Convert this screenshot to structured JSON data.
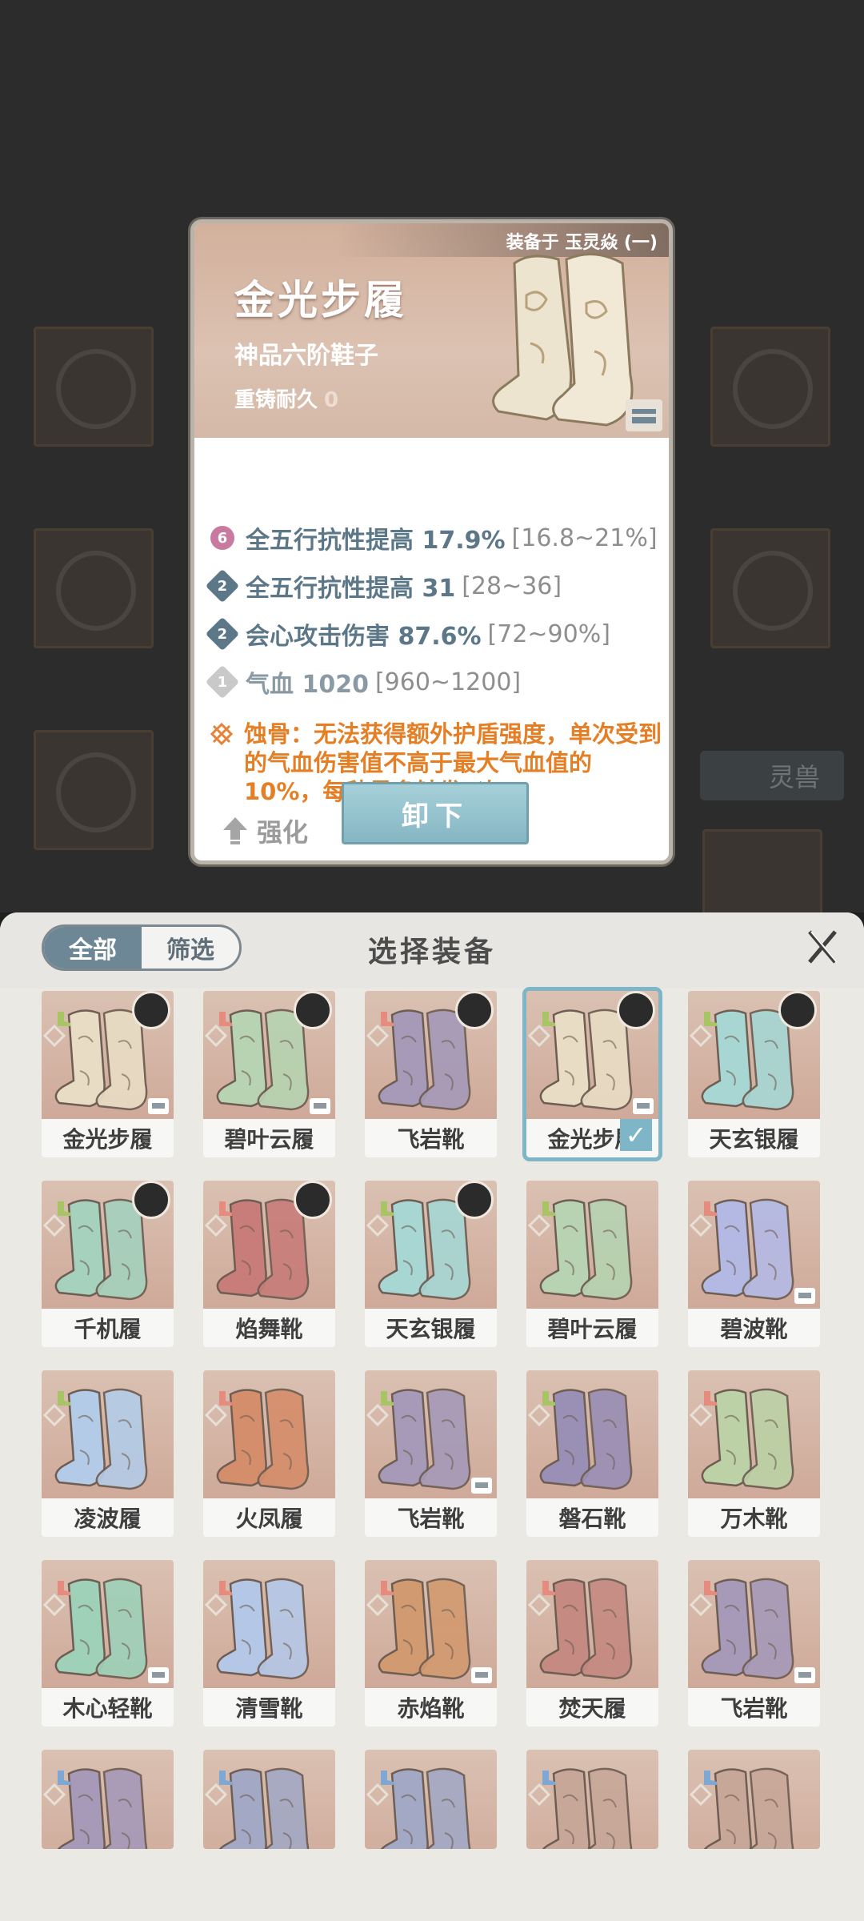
{
  "background": {
    "tag_label": "灵兽"
  },
  "detail": {
    "equipped_on": "装备于 玉灵焱 (一)",
    "name": "金光步履",
    "grade": "神品六阶鞋子",
    "recast_label": "重铸耐久",
    "recast_value": "0",
    "stats": [
      {
        "badge": "6",
        "text": "全五行抗性提高 17.9%",
        "range": "[16.8~21%]",
        "badge_color": "#c97a9f"
      },
      {
        "badge": "2",
        "text": "全五行抗性提高 31",
        "range": "[28~36]",
        "badge_color": "#5b7788"
      },
      {
        "badge": "2",
        "text": "会心攻击伤害 87.6%",
        "range": "[72~90%]",
        "badge_color": "#5b7788"
      },
      {
        "badge": "1",
        "text": "气血 1020",
        "range": "[960~1200]",
        "badge_color": "#c9c9c9"
      }
    ],
    "skill_text": "蚀骨：无法获得额外护盾强度，单次受到的气血伤害值不高于最大气血值的10%，每秒最多触发1次",
    "upgrade_label": "强化",
    "unequip_label": "卸下"
  },
  "panel": {
    "tab_all": "全部",
    "tab_filter": "筛选",
    "title": "选择装备",
    "items": [
      {
        "name": "金光步履",
        "color": "#e8dcc4"
      },
      {
        "name": "碧叶云履",
        "color": "#b7d3b1"
      },
      {
        "name": "飞岩靴",
        "color": "#a69ab8"
      },
      {
        "name": "金光步履",
        "color": "#e8dcc4"
      },
      {
        "name": "天玄银履",
        "color": "#a7d6d3"
      },
      {
        "name": "千机履",
        "color": "#a5d1bd"
      },
      {
        "name": "焰舞靴",
        "color": "#c87d7a"
      },
      {
        "name": "天玄银履",
        "color": "#a7d6d3"
      },
      {
        "name": "碧叶云履",
        "color": "#b7d3b1"
      },
      {
        "name": "碧波靴",
        "color": "#b4b9e4"
      },
      {
        "name": "凌波履",
        "color": "#b3cbe6"
      },
      {
        "name": "火凤履",
        "color": "#d58e6b"
      },
      {
        "name": "飞岩靴",
        "color": "#a69ab8"
      },
      {
        "name": "磐石靴",
        "color": "#9a8fb5"
      },
      {
        "name": "万木靴",
        "color": "#bcd1a6"
      },
      {
        "name": "木心轻靴",
        "color": "#9fd0b8"
      },
      {
        "name": "清雪靴",
        "color": "#b5c7e6"
      },
      {
        "name": "赤焰靴",
        "color": "#d29a70"
      },
      {
        "name": "焚天履",
        "color": "#c58a82"
      },
      {
        "name": "飞岩靴",
        "color": "#a69ab8"
      },
      {
        "name": "",
        "color": "#a69ab8"
      },
      {
        "name": "",
        "color": "#a3a9c4"
      },
      {
        "name": "",
        "color": "#a3a9c4"
      },
      {
        "name": "",
        "color": "#c7a898"
      },
      {
        "name": "",
        "color": "#c7a898"
      }
    ]
  },
  "colors": {
    "accent": "#6e8797",
    "skill": "#e47f26",
    "stat": "#5b7788"
  }
}
